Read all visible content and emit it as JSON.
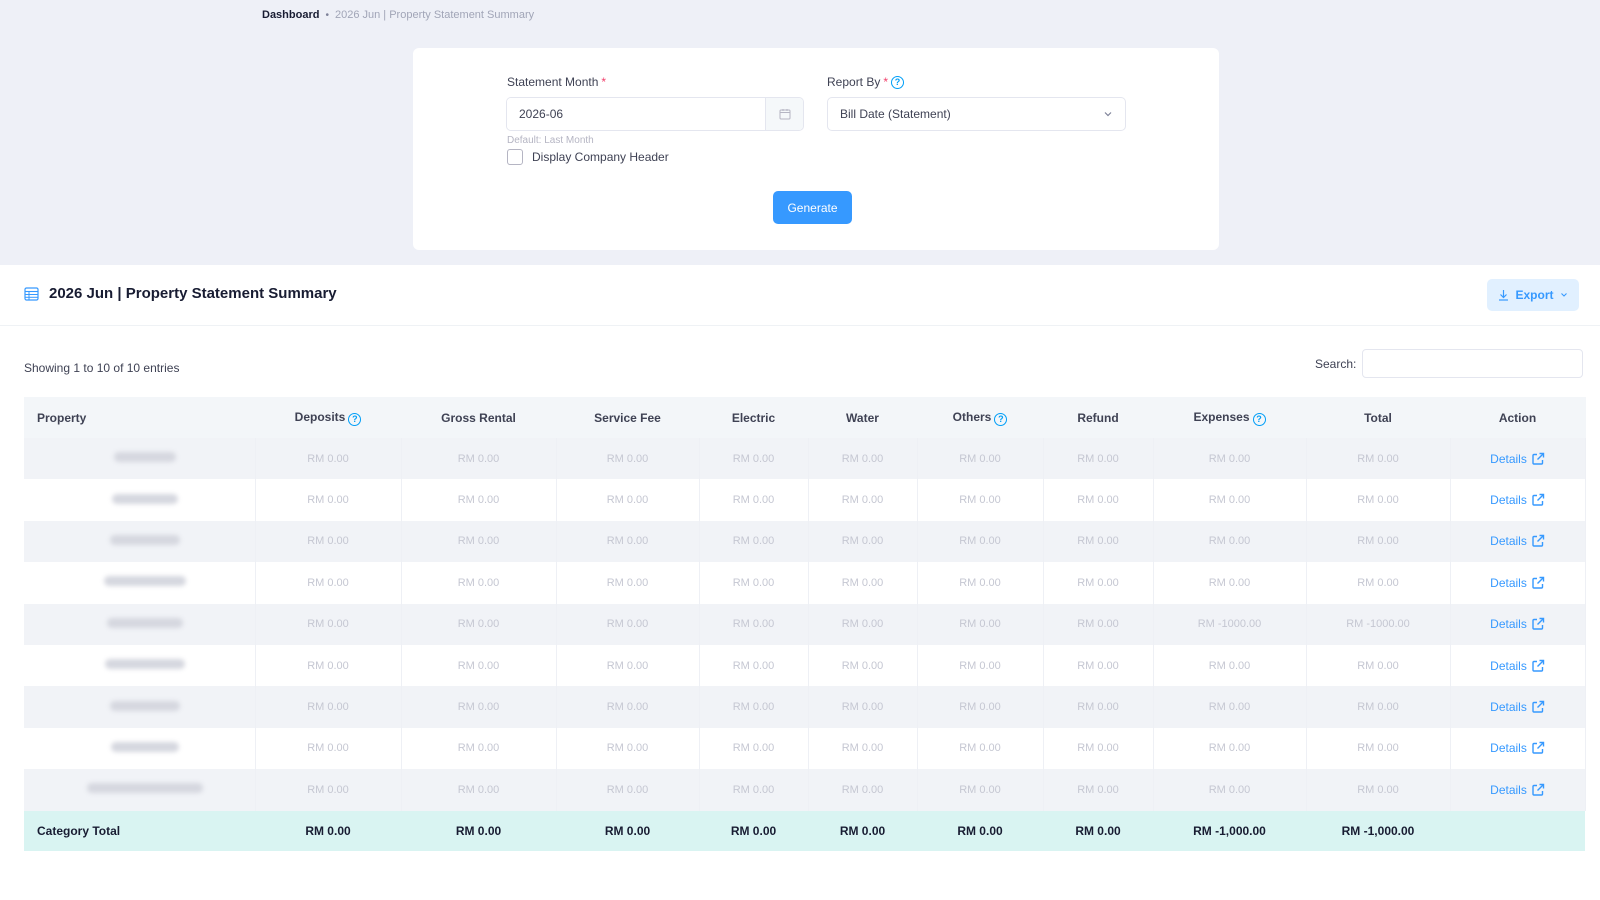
{
  "breadcrumb": {
    "home": "Dashboard",
    "separator": "•",
    "current": "2026 Jun | Property Statement Summary"
  },
  "filters": {
    "statement_month_label": "Statement Month",
    "required_mark": "*",
    "statement_month_value": "2026-06",
    "statement_month_hint": "Default: Last Month",
    "report_by_label": "Report By",
    "report_by_value": "Bill Date (Statement)",
    "display_company_header_label": "Display Company Header",
    "display_company_header_checked": false,
    "generate_label": "Generate",
    "help_glyph": "?"
  },
  "report": {
    "title": "2026 Jun | Property Statement Summary",
    "export_label": "Export",
    "entries_info": "Showing 1 to 10 of 10 entries",
    "search_label": "Search:",
    "search_value": ""
  },
  "table": {
    "columns": [
      {
        "label": "Property",
        "help": false
      },
      {
        "label": "Deposits",
        "help": true
      },
      {
        "label": "Gross Rental",
        "help": false
      },
      {
        "label": "Service Fee",
        "help": false
      },
      {
        "label": "Electric",
        "help": false
      },
      {
        "label": "Water",
        "help": false
      },
      {
        "label": "Others",
        "help": true
      },
      {
        "label": "Refund",
        "help": false
      },
      {
        "label": "Expenses",
        "help": true
      },
      {
        "label": "Total",
        "help": false
      },
      {
        "label": "Action",
        "help": false
      }
    ],
    "rows": [
      {
        "values": [
          "RM 0.00",
          "RM 0.00",
          "RM 0.00",
          "RM 0.00",
          "RM 0.00",
          "RM 0.00",
          "RM 0.00",
          "RM 0.00",
          "RM 0.00"
        ],
        "action": "Details"
      },
      {
        "values": [
          "RM 0.00",
          "RM 0.00",
          "RM 0.00",
          "RM 0.00",
          "RM 0.00",
          "RM 0.00",
          "RM 0.00",
          "RM 0.00",
          "RM 0.00"
        ],
        "action": "Details"
      },
      {
        "values": [
          "RM 0.00",
          "RM 0.00",
          "RM 0.00",
          "RM 0.00",
          "RM 0.00",
          "RM 0.00",
          "RM 0.00",
          "RM 0.00",
          "RM 0.00"
        ],
        "action": "Details"
      },
      {
        "values": [
          "RM 0.00",
          "RM 0.00",
          "RM 0.00",
          "RM 0.00",
          "RM 0.00",
          "RM 0.00",
          "RM 0.00",
          "RM 0.00",
          "RM 0.00"
        ],
        "action": "Details"
      },
      {
        "values": [
          "RM 0.00",
          "RM 0.00",
          "RM 0.00",
          "RM 0.00",
          "RM 0.00",
          "RM 0.00",
          "RM 0.00",
          "RM -1000.00",
          "RM -1000.00"
        ],
        "action": "Details"
      },
      {
        "values": [
          "RM 0.00",
          "RM 0.00",
          "RM 0.00",
          "RM 0.00",
          "RM 0.00",
          "RM 0.00",
          "RM 0.00",
          "RM 0.00",
          "RM 0.00"
        ],
        "action": "Details"
      },
      {
        "values": [
          "RM 0.00",
          "RM 0.00",
          "RM 0.00",
          "RM 0.00",
          "RM 0.00",
          "RM 0.00",
          "RM 0.00",
          "RM 0.00",
          "RM 0.00"
        ],
        "action": "Details"
      },
      {
        "values": [
          "RM 0.00",
          "RM 0.00",
          "RM 0.00",
          "RM 0.00",
          "RM 0.00",
          "RM 0.00",
          "RM 0.00",
          "RM 0.00",
          "RM 0.00"
        ],
        "action": "Details"
      },
      {
        "values": [
          "RM 0.00",
          "RM 0.00",
          "RM 0.00",
          "RM 0.00",
          "RM 0.00",
          "RM 0.00",
          "RM 0.00",
          "RM 0.00",
          "RM 0.00"
        ],
        "action": "Details"
      }
    ],
    "footer": {
      "label": "Category Total",
      "values": [
        "RM 0.00",
        "RM 0.00",
        "RM 0.00",
        "RM 0.00",
        "RM 0.00",
        "RM 0.00",
        "RM 0.00",
        "RM -1,000.00",
        "RM -1,000.00"
      ]
    }
  },
  "icons": {
    "calendar": "calendar-icon",
    "chevron": "chevron-down-icon",
    "table": "table-icon",
    "download": "download-icon",
    "external_link": "external-link-icon"
  },
  "colors": {
    "primary": "#3699ff",
    "primary_light": "#e1f0ff",
    "required": "#f1416c",
    "total_row": "#d9f4f2",
    "page_background": "#eef0f7"
  }
}
